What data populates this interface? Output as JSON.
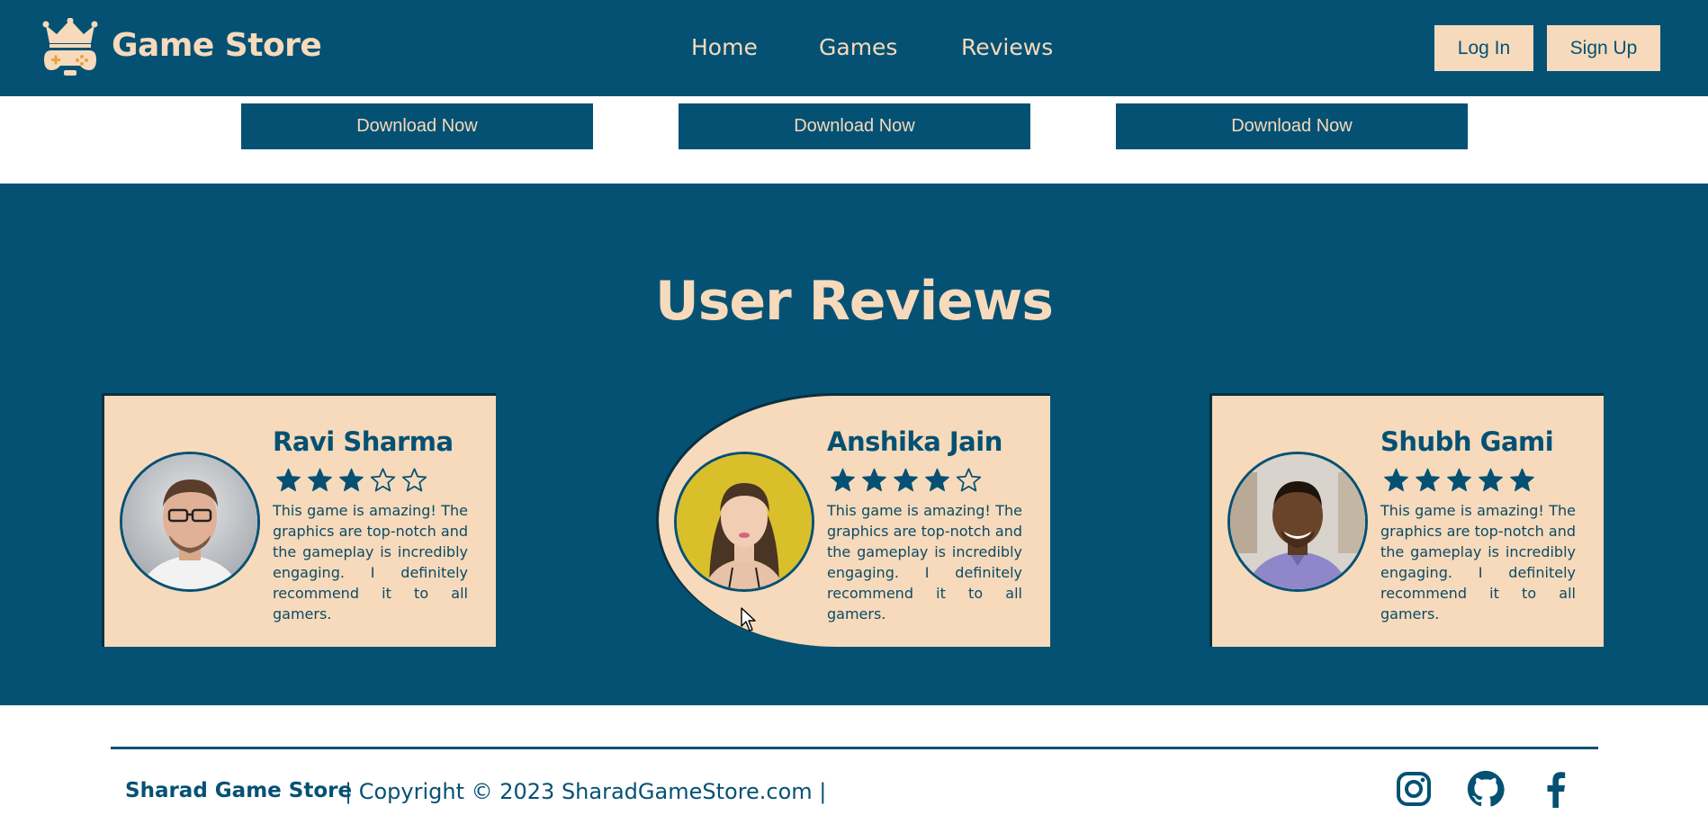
{
  "header": {
    "brand": "Game Store",
    "nav": {
      "home": "Home",
      "games": "Games",
      "reviews": "Reviews"
    },
    "login_label": "Log In",
    "signup_label": "Sign Up"
  },
  "downloads": [
    "Download Now",
    "Download Now",
    "Download Now"
  ],
  "reviews": {
    "title": "User Reviews",
    "cards": [
      {
        "name": "Ravi Sharma",
        "rating": 3,
        "max_rating": 5,
        "text": "This game is amazing! The graphics are top-notch and the gameplay is incredibly engaging. I definitely recommend it to all gamers."
      },
      {
        "name": "Anshika Jain",
        "rating": 4,
        "max_rating": 5,
        "text": "This game is amazing! The graphics are top-notch and the gameplay is incredibly engaging. I definitely recommend it to all gamers."
      },
      {
        "name": "Shubh Gami",
        "rating": 5,
        "max_rating": 5,
        "text": "This game is amazing! The graphics are top-notch and the gameplay is incredibly engaging. I definitely recommend it to all gamers."
      }
    ]
  },
  "footer": {
    "brand": "Sharad Game Store",
    "copyright": "| Copyright © 2023 SharadGameStore.com |",
    "social_icons": [
      "instagram-icon",
      "github-icon",
      "facebook-icon"
    ]
  },
  "colors": {
    "primary": "#055174",
    "cream": "#f6dabb",
    "accent": "#e8a33c"
  }
}
